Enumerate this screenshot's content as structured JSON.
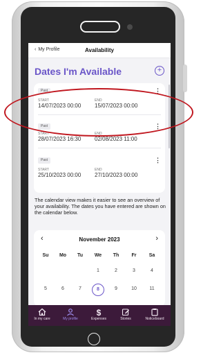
{
  "topbar": {
    "back_label": "My Profile",
    "title": "Availability"
  },
  "page": {
    "heading": "Dates I'm Available"
  },
  "availability": [
    {
      "status": "Past",
      "start_label": "START",
      "start": "14/07/2023 00:00",
      "end_label": "END",
      "end": "15/07/2023 00:00"
    },
    {
      "status": "Past",
      "start_label": "START",
      "start": "28/07/2023 16:30",
      "end_label": "END",
      "end": "02/08/2023 11:00"
    },
    {
      "status": "Past",
      "start_label": "START",
      "start": "25/10/2023 00:00",
      "end_label": "END",
      "end": "27/10/2023 00:00"
    }
  ],
  "info_text": "The calendar view makes it easier to see an overview of your availability. The dates you have entered are shown on the calendar below.",
  "calendar": {
    "month_label": "November 2023",
    "weekdays": [
      "Su",
      "Mo",
      "Tu",
      "We",
      "Th",
      "Fr",
      "Sa"
    ],
    "week1": [
      "1",
      "2",
      "3",
      "4"
    ],
    "week2": [
      "5",
      "6",
      "7",
      "8",
      "9",
      "10",
      "11"
    ],
    "selected_day": "8"
  },
  "tabs": [
    {
      "label": "In my care",
      "icon": "home-icon",
      "active": false
    },
    {
      "label": "My profile",
      "icon": "person-icon",
      "active": true
    },
    {
      "label": "Expenses",
      "icon": "dollar-icon",
      "active": false
    },
    {
      "label": "Stories",
      "icon": "edit-icon",
      "active": false
    },
    {
      "label": "Noticeboard",
      "icon": "clipboard-icon",
      "active": false
    }
  ],
  "colors": {
    "accent": "#6a55c8",
    "tabbar": "#3c1a3a",
    "highlight": "#c0161e"
  }
}
